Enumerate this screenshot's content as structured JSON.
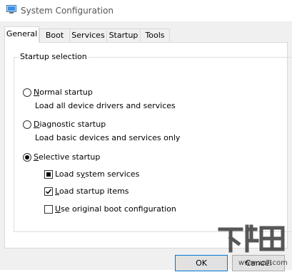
{
  "window": {
    "title": "System Configuration"
  },
  "tabs": [
    {
      "label": "General",
      "active": true
    },
    {
      "label": "Boot",
      "active": false
    },
    {
      "label": "Services",
      "active": false
    },
    {
      "label": "Startup",
      "active": false
    },
    {
      "label": "Tools",
      "active": false
    }
  ],
  "startup_selection": {
    "group_label": "Startup selection",
    "options": [
      {
        "label": "Normal startup",
        "underline_char": "N",
        "description": "Load all device drivers and services",
        "selected": false
      },
      {
        "label": "Diagnostic startup",
        "underline_char": "D",
        "description": "Load basic devices and services only",
        "selected": false
      },
      {
        "label": "Selective startup",
        "underline_char": "S",
        "description": "",
        "selected": true
      }
    ],
    "selective_options": [
      {
        "label": "Load system services",
        "state": "indeterminate"
      },
      {
        "label": "Load startup items",
        "state": "checked"
      },
      {
        "label": "Use original boot configuration",
        "state": "unchecked"
      }
    ]
  },
  "buttons": {
    "ok": "OK",
    "cancel": "Cancel"
  },
  "icons": {
    "app": "system-configuration-icon",
    "watermark": "watermark-logo"
  },
  "colors": {
    "accent": "#0078d7",
    "dialog_bg": "#f0f0f0",
    "panel_bg": "#ffffff"
  }
}
